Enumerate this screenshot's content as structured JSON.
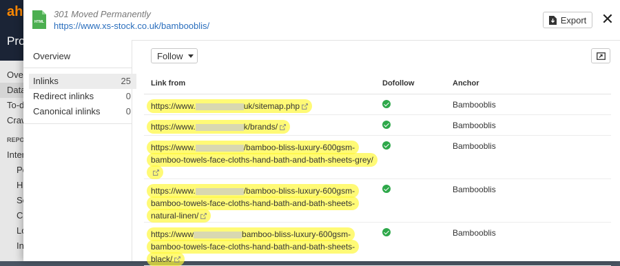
{
  "background_app": {
    "logo": "ah",
    "section": "Pro",
    "menu": [
      "Over",
      "Data",
      "To-d",
      "Craw"
    ],
    "section_header": "REPO",
    "sub_items": [
      "Inter",
      "Pe",
      "H",
      "Se",
      "C",
      "Lo",
      "In"
    ]
  },
  "modal": {
    "status": "301 Moved Permanently",
    "url": "https://www.xs-stock.co.uk/bambooblis/",
    "export_label": "Export",
    "close_glyph": "✕"
  },
  "side_nav": {
    "overview": "Overview",
    "items": [
      {
        "label": "Inlinks",
        "count": "25",
        "active": true
      },
      {
        "label": "Redirect inlinks",
        "count": "0",
        "active": false
      },
      {
        "label": "Canonical inlinks",
        "count": "0",
        "active": false
      }
    ]
  },
  "toolbar": {
    "follow_label": "Follow"
  },
  "table": {
    "headers": {
      "from": "Link from",
      "dofollow": "Dofollow",
      "anchor": "Anchor"
    },
    "rows": [
      {
        "prefix": "https://www.",
        "suffix": "uk/sitemap.php",
        "dofollow": true,
        "anchor": "Bambooblis"
      },
      {
        "prefix": "https://www.",
        "suffix": "k/brands/",
        "dofollow": true,
        "anchor": "Bambooblis"
      },
      {
        "prefix": "https://www.",
        "suffix": "/bamboo-bliss-luxury-600gsm-bamboo-towels-face-cloths-hand-bath-and-bath-sheets-grey/",
        "dofollow": true,
        "anchor": "Bambooblis"
      },
      {
        "prefix": "https://www.",
        "suffix": "/bamboo-bliss-luxury-600gsm-bamboo-towels-face-cloths-hand-bath-and-bath-sheets-natural-linen/",
        "dofollow": true,
        "anchor": "Bambooblis"
      },
      {
        "prefix": "https://www",
        "suffix": "bamboo-bliss-luxury-600gsm-bamboo-towels-face-cloths-hand-bath-and-bath-sheets-black/",
        "dofollow": true,
        "anchor": "Bambooblis"
      }
    ]
  },
  "colors": {
    "link": "#2a6ebd",
    "highlight": "#fff83c",
    "check": "#2ea84a",
    "file_icon": "#4caf50"
  }
}
